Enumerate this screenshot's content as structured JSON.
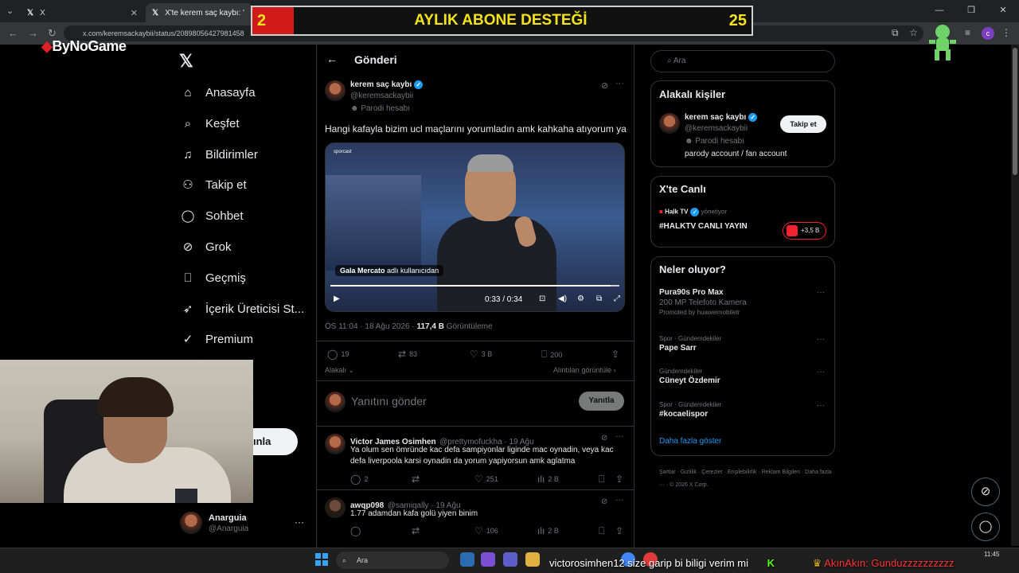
{
  "browser": {
    "tabs": [
      {
        "icon": "x-logo-icon",
        "title": "X"
      },
      {
        "icon": "x-logo-icon",
        "title": "X'te kerem saç kaybı: \"Hangi k"
      }
    ],
    "url": "x.com/keremsackaybii/status/20898056427981458"
  },
  "overlay": {
    "banner_left": "2",
    "banner_title": "AYLIK ABONE DESTEĞİ",
    "banner_right": "25",
    "logo_b": "B",
    "logo_rest": "yNoGame"
  },
  "nav": {
    "items": [
      {
        "icon": "home-icon",
        "glyph": "⌂",
        "label": "Anasayfa"
      },
      {
        "icon": "search-icon",
        "glyph": "⌕",
        "label": "Keşfet"
      },
      {
        "icon": "bell-icon",
        "glyph": "♫",
        "label": "Bildirimler"
      },
      {
        "icon": "follow-icon",
        "glyph": "⚇",
        "label": "Takip et"
      },
      {
        "icon": "chat-icon",
        "glyph": "◯",
        "label": "Sohbet"
      },
      {
        "icon": "grok-icon",
        "glyph": "⊘",
        "label": "Grok"
      },
      {
        "icon": "bookmark-icon",
        "glyph": "⎕",
        "label": "Geçmiş"
      },
      {
        "icon": "rocket-icon",
        "glyph": "➶",
        "label": "İçerik Üreticisi St..."
      },
      {
        "icon": "premium-icon",
        "glyph": "✓",
        "label": "Premium"
      }
    ],
    "post_label": "ınla",
    "profile_name": "Anarguia",
    "profile_handle": "@Anarguia"
  },
  "post": {
    "header": "Gönderi",
    "author_name": "kerem saç kaybı",
    "author_handle": "@keremsackaybii",
    "author_badge": "Parodi hesabı",
    "text": "Hangi kafayla bizim ucl maçlarını yorumladın amk kahkaha atıyorum ya",
    "video": {
      "brand": "sporcast",
      "tag_name": "Gala Mercato",
      "tag_suffix": " adlı kullanıcıdan",
      "time": "0:33 / 0:34",
      "progress": 0.97
    },
    "time_line": "ÖS 11:04 · 18 Ağu 2026 · ",
    "views": "117,4 B",
    "views_label": " Görüntüleme",
    "stats": {
      "replies": "19",
      "reposts": "83",
      "likes": "3 B",
      "bookmarks": "200"
    },
    "relevant_label": "Alakalı",
    "quotes_label": "Alıntıları görüntüle",
    "reply_placeholder": "Yanıtını gönder",
    "reply_button": "Yanıtla"
  },
  "replies": [
    {
      "name": "Victor James Osimhen",
      "handle": "@prettymofuckha · 19 Ağu",
      "text": "Ya olum sen ömründe kac defa sampiyonlar liginde mac oynadin, veya kac defa liverpoola karsi oynadin da yorum yapiyorsun amk aglatma",
      "replies": "2",
      "reposts": "",
      "likes": "251",
      "views": "2 B"
    },
    {
      "name": "awqp098",
      "handle": "@samiqally · 19 Ağu",
      "text": "1.77 adamdan kafa golü yiyen binim",
      "replies": "",
      "reposts": "",
      "likes": "106",
      "views": "2 B"
    }
  ],
  "right": {
    "search_placeholder": "Ara",
    "relevant": {
      "title": "Alakalı kişiler",
      "name": "kerem saç kaybı",
      "handle": "@keremsackaybii",
      "badge": "Parodi hesabı",
      "bio": "parody account / fan account",
      "follow": "Takip et"
    },
    "live": {
      "title": "X'te Canlı",
      "host": "Halk TV",
      "host_role": "yönetiyor",
      "stream": "#HALKTV CANLI YAYIN",
      "listeners": "+3,5 B"
    },
    "trends": {
      "title": "Neler oluyor?",
      "items": [
        {
          "meta": "",
          "name": "Pura90s Pro Max",
          "sub": "200 MP Telefoto Kamera",
          "promo": "Promoted by huaweimobiletr"
        },
        {
          "meta": "Spor · Gündemdekiler",
          "name": "Pape Sarr",
          "sub": "",
          "promo": ""
        },
        {
          "meta": "Gündemdekiler",
          "name": "Cüneyt Özdemir",
          "sub": "",
          "promo": ""
        },
        {
          "meta": "Spor · Gündemdekiler",
          "name": "#kocaelispor",
          "sub": "",
          "promo": ""
        }
      ],
      "more": "Daha fazla göster"
    },
    "footer": "Şartlar  ·  Gizlilik  ·  Çerezler  ·  Erişilebilirlik  ·  Reklam Bilgileri  ·  Daha fazla ···  ·  © 2026 X Corp."
  },
  "taskbar": {
    "search_placeholder": "Ara",
    "chat_ticker": "victorosimhen12 size garip bi biligi verim mi",
    "ticker_tail": "AkınAkın: Gunduzzzzzzzzzz",
    "time": "11:45"
  }
}
